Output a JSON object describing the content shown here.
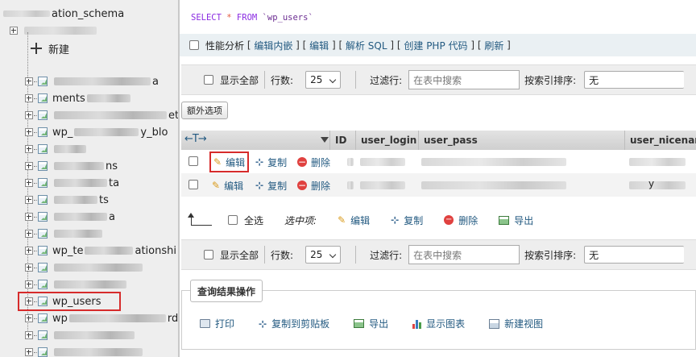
{
  "sidebar": {
    "db_name_suffix": "ation_schema",
    "new_label": "新建",
    "tables": [
      {
        "label": "a",
        "blur_width": 120
      },
      {
        "label": "ments",
        "blur_width": 54
      },
      {
        "label": "et",
        "blur_width": 140
      },
      {
        "label": "wp_",
        "label2": "y_blo",
        "blur_width": 80
      },
      {
        "label": "",
        "blur_width": 40
      },
      {
        "label": "ns",
        "blur_width": 62
      },
      {
        "label": "ta",
        "blur_width": 66
      },
      {
        "label": "ts",
        "blur_width": 54
      },
      {
        "label": "a",
        "blur_width": 66
      },
      {
        "label": "",
        "blur_width": 60
      },
      {
        "label": "wp_te",
        "label2": "ationshi",
        "blur_width": 60
      },
      {
        "label": "",
        "blur_width": 110
      },
      {
        "label": "",
        "blur_width": 90
      },
      {
        "label": "wp_users",
        "blur_width": 0,
        "active": true
      },
      {
        "label": "wp",
        "label2": "rd",
        "blur_width": 120
      },
      {
        "label": "",
        "blur_width": 100
      },
      {
        "label": "",
        "blur_width": 110
      }
    ]
  },
  "sql": {
    "kw_select": "SELECT",
    "star": "*",
    "kw_from": "FROM",
    "table": "`wp_users`"
  },
  "perf_bar": {
    "label": "性能分析",
    "links": [
      "编辑内嵌",
      "编辑",
      "解析 SQL",
      "创建 PHP 代码",
      "刷新"
    ]
  },
  "nav": {
    "show_all": "显示全部",
    "rows_label": "行数:",
    "rows_value": "25",
    "filter_label": "过滤行:",
    "filter_placeholder": "在表中搜索",
    "sort_label": "按索引排序:",
    "sort_value": "无"
  },
  "extra_options": "额外选项",
  "grid": {
    "arrows": "←T→",
    "columns": [
      "ID",
      "user_login",
      "user_pass",
      "user_nicename"
    ],
    "actions": {
      "edit": "编辑",
      "copy": "复制",
      "delete": "删除"
    },
    "rows": [
      {
        "tail": ""
      },
      {
        "tail": "y"
      }
    ]
  },
  "bulk": {
    "select_all": "全选",
    "with_selected": "选中项:",
    "edit": "编辑",
    "copy": "复制",
    "delete": "删除",
    "export": "导出"
  },
  "query_ops": {
    "title": "查询结果操作",
    "print": "打印",
    "copy_clipboard": "复制到剪贴板",
    "export": "导出",
    "show_chart": "显示图表",
    "create_view": "新建视图"
  },
  "colors": {
    "link": "#235a81",
    "highlight_border": "#d62b2b",
    "sidebar_bg": "#eeeeee",
    "perf_bar_bg": "#eaf0f3"
  }
}
